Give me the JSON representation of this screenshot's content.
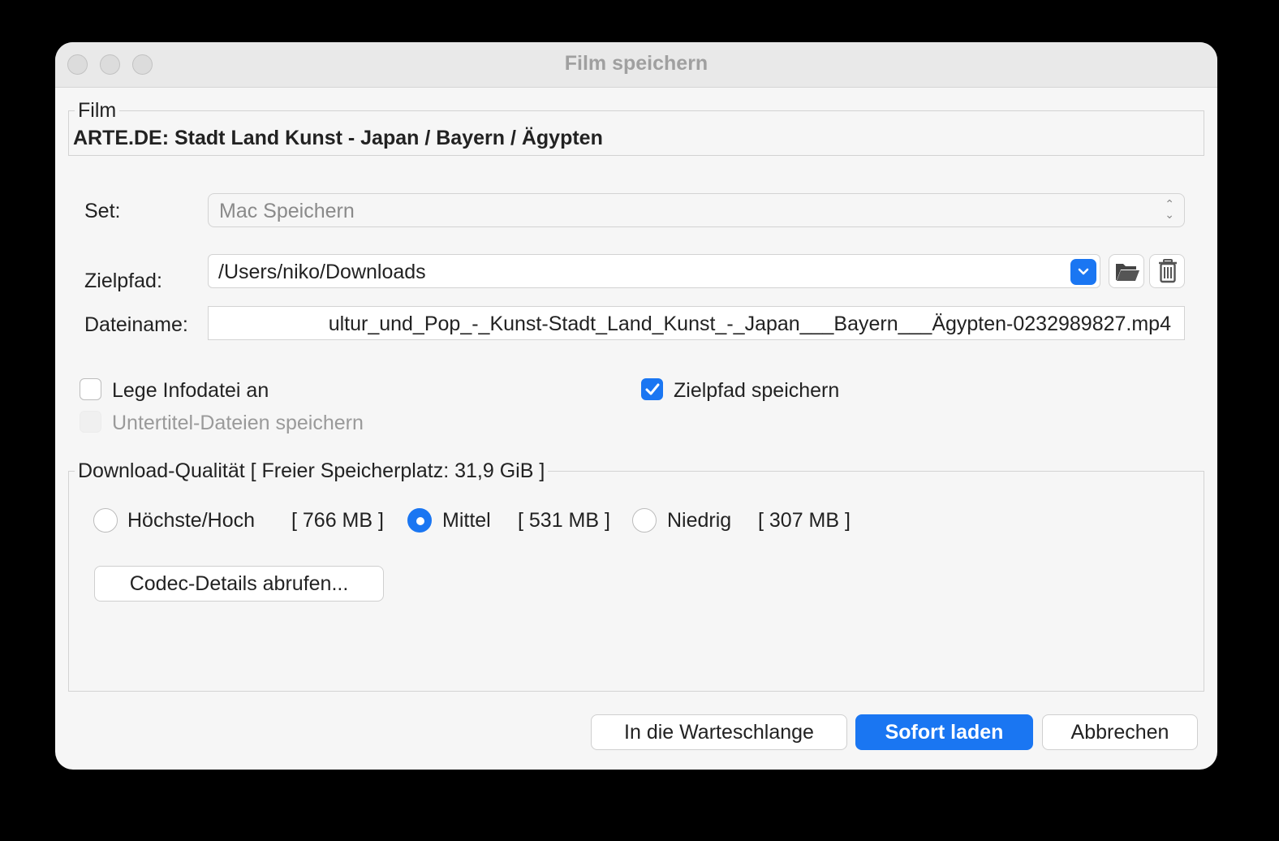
{
  "window": {
    "title": "Film speichern"
  },
  "film": {
    "legend": "Film",
    "title": "ARTE.DE: Stadt Land Kunst - Japan / Bayern / Ägypten"
  },
  "set": {
    "label": "Set:",
    "value": "Mac Speichern"
  },
  "zielpfad": {
    "label": "Zielpfad:",
    "value": "/Users/niko/Downloads"
  },
  "icons": {
    "folder": "folder-open-icon",
    "trash": "trash-icon",
    "dropdown": "chevron-down-icon"
  },
  "dateiname": {
    "label": "Dateiname:",
    "value": "ultur_und_Pop_-_Kunst-Stadt_Land_Kunst_-_Japan___Bayern___Ägypten-0232989827.mp4"
  },
  "options": {
    "infodatei": {
      "label": "Lege Infodatei an",
      "checked": false
    },
    "zielpfad_speichern": {
      "label": "Zielpfad speichern",
      "checked": true
    },
    "untertitel": {
      "label": "Untertitel-Dateien speichern",
      "checked": false,
      "disabled": true
    }
  },
  "quality": {
    "legend": "Download-Qualität [ Freier Speicherplatz: 31,9 GiB ]",
    "options": [
      {
        "label": "Höchste/Hoch",
        "size": "[ 766 MB ]",
        "selected": false
      },
      {
        "label": "Mittel",
        "size": "[ 531 MB ]",
        "selected": true
      },
      {
        "label": "Niedrig",
        "size": "[ 307 MB ]",
        "selected": false
      }
    ],
    "codec_button": "Codec-Details abrufen..."
  },
  "buttons": {
    "queue": "In die Warteschlange",
    "now": "Sofort laden",
    "cancel": "Abbrechen"
  },
  "colors": {
    "accent": "#1a76f2",
    "window_bg": "#f6f6f6"
  }
}
